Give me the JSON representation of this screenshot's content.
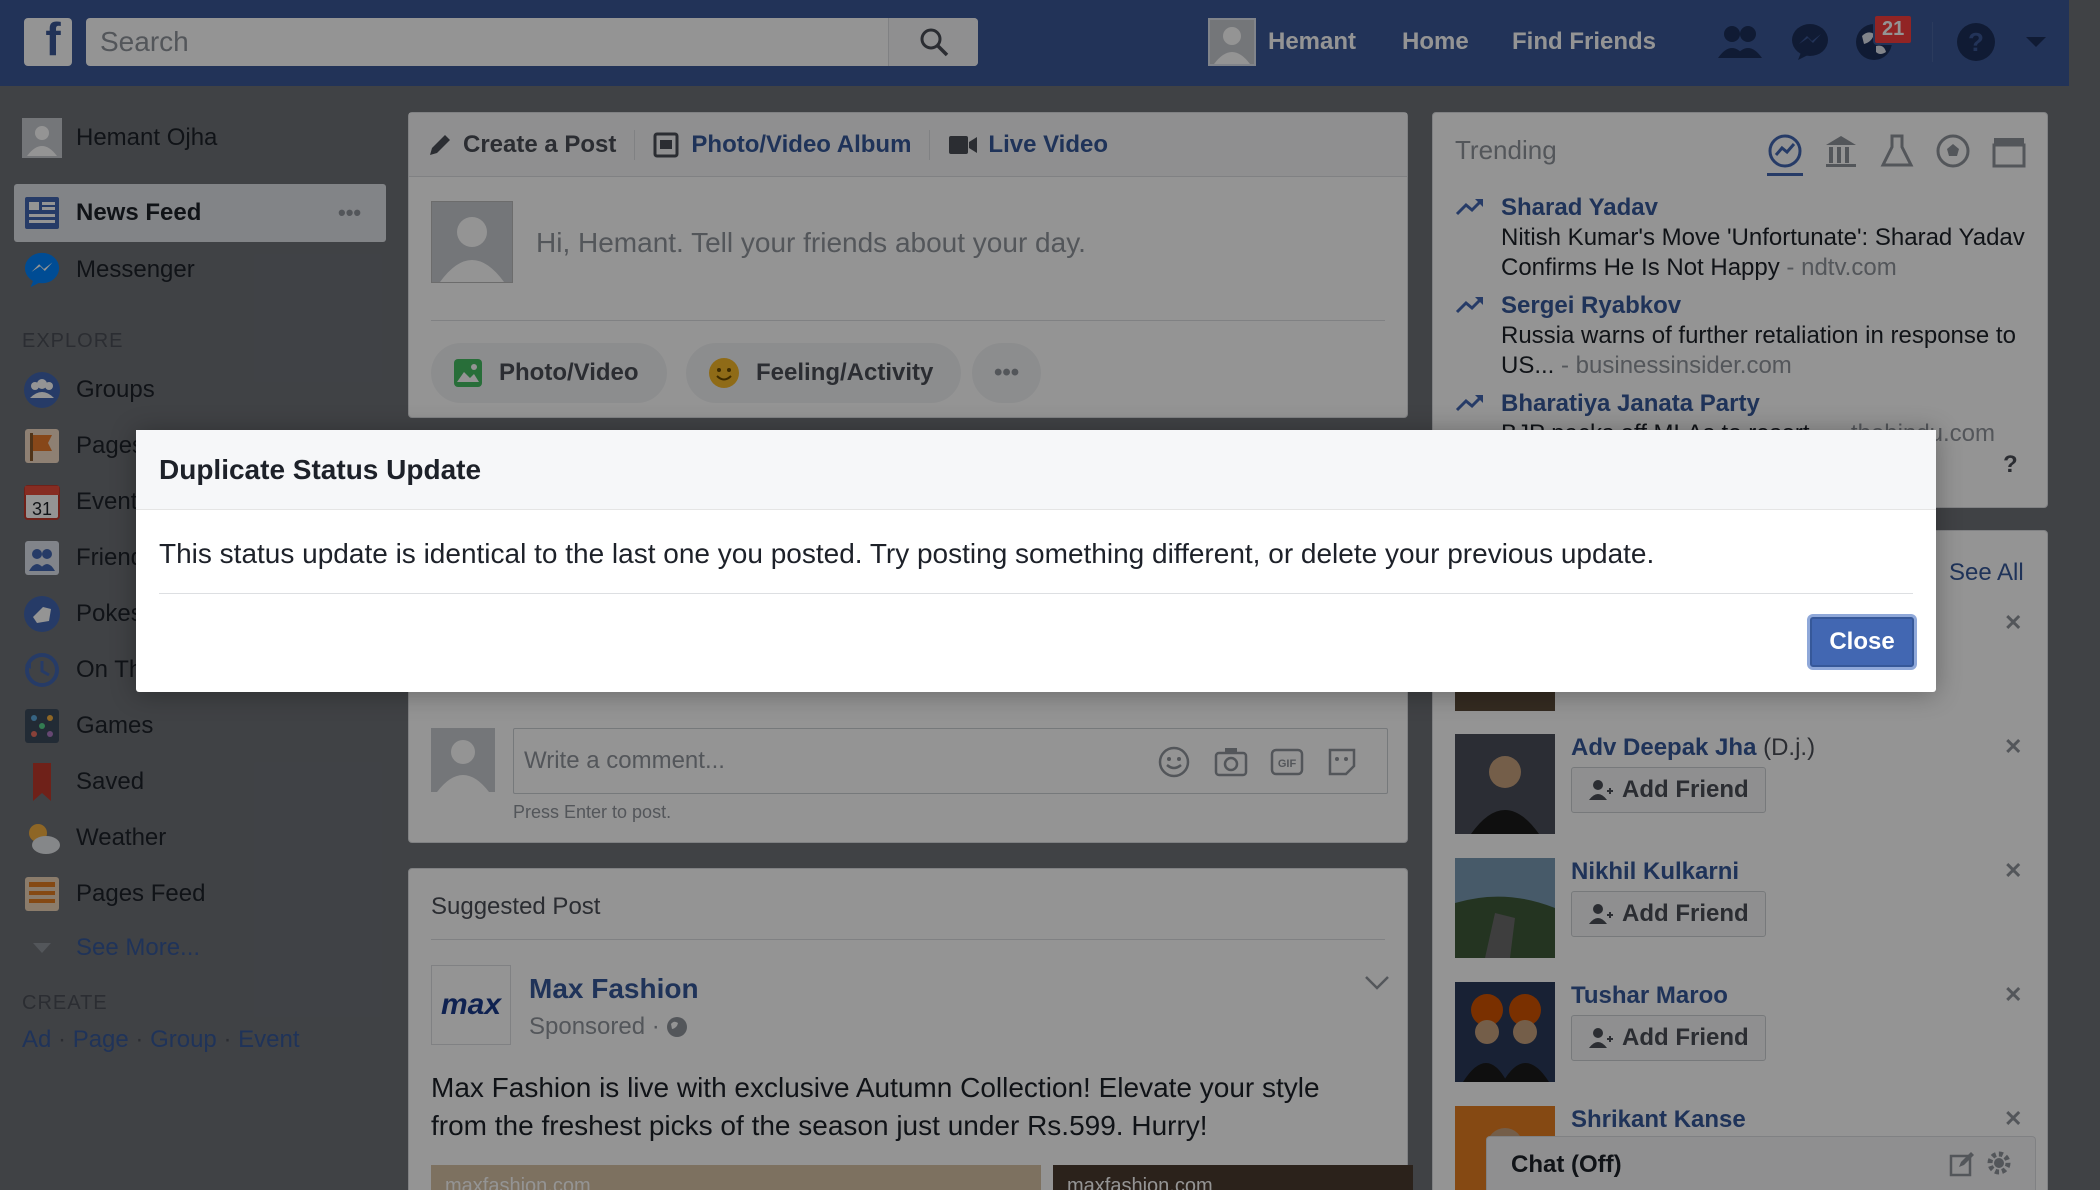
{
  "topbar": {
    "search_placeholder": "Search",
    "user_name": "Hemant",
    "home": "Home",
    "find_friends": "Find Friends",
    "notifications_count": "21"
  },
  "left_nav": {
    "profile_name": "Hemant Ojha",
    "news_feed": "News Feed",
    "messenger": "Messenger",
    "explore_header": "EXPLORE",
    "explore_items": [
      "Groups",
      "Pages",
      "Events",
      "Friend Lists",
      "Pokes",
      "On This Day",
      "Games",
      "Saved",
      "Weather",
      "Pages Feed"
    ],
    "see_more": "See More...",
    "create_header": "CREATE",
    "create_links": [
      "Ad",
      "Page",
      "Group",
      "Event"
    ]
  },
  "composer": {
    "tab_create_post": "Create a Post",
    "tab_album": "Photo/Video Album",
    "tab_live": "Live Video",
    "prompt": "Hi, Hemant. Tell your friends about your day.",
    "photo_video": "Photo/Video",
    "feeling": "Feeling/Activity",
    "more": "•••"
  },
  "comment": {
    "placeholder": "Write a comment...",
    "hint": "Press Enter to post."
  },
  "suggested": {
    "header": "Suggested Post",
    "page_name": "Max Fashion",
    "sponsored": "Sponsored ·",
    "text": "Max Fashion is live with exclusive Autumn Collection! Elevate your style from the freshest picks of the season just under Rs.599. Hurry!",
    "logo_text": "max",
    "image_caption_1": "maxfashion.com",
    "image_caption_2": "maxfashion.com"
  },
  "trending": {
    "title": "Trending",
    "items": [
      {
        "name": "Sharad Yadav",
        "text": "Nitish Kumar's Move 'Unfortunate': Sharad Yadav Confirms He Is Not Happy",
        "source": " - ndtv.com"
      },
      {
        "name": "Sergei Ryabkov",
        "text": "Russia warns of further retaliation in response to US...",
        "source": " - businessinsider.com"
      },
      {
        "name": "Bharatiya Janata Party",
        "text": "BJP packs off MLAs to resort...",
        "source": " - thehindu.com"
      }
    ],
    "help": "?"
  },
  "people": {
    "see_all": "See All",
    "add_friend": "Add Friend",
    "list": [
      {
        "name": "Adv Deepak Jha",
        "extra": " (D.j.)"
      },
      {
        "name": "Nikhil Kulkarni",
        "extra": ""
      },
      {
        "name": "Tushar Maroo",
        "extra": ""
      },
      {
        "name": "Shrikant Kanse",
        "extra": ""
      }
    ]
  },
  "chat": {
    "label": "Chat (Off)"
  },
  "modal": {
    "title": "Duplicate Status Update",
    "message": "This status update is identical to the last one you posted. Try posting something different, or delete your previous update.",
    "close": "Close"
  }
}
